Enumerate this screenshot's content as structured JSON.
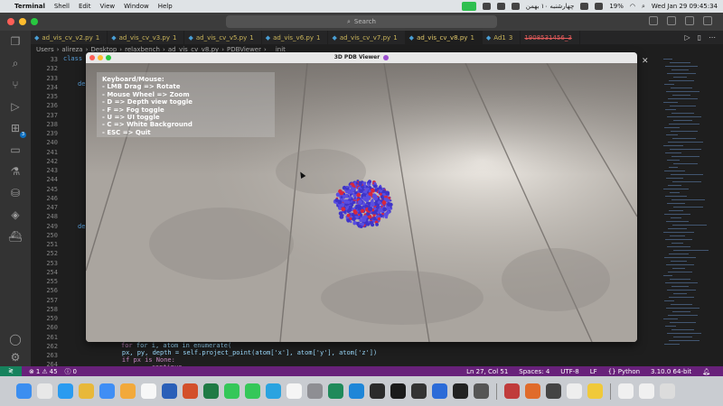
{
  "menubar": {
    "app_name": "Terminal",
    "items": [
      "Shell",
      "Edit",
      "View",
      "Window",
      "Help"
    ],
    "date_fa": "چهارشنبه ۱۰ بهمن",
    "battery": "19%",
    "clock": "Wed Jan 29  09:45:34"
  },
  "titlebar": {
    "search_placeholder": "Search"
  },
  "tabs": [
    {
      "label": "ad_vis_cv_v2.py",
      "badge": "1",
      "icon": "python-icon",
      "active": false,
      "strike": false
    },
    {
      "label": "ad_vis_cv_v3.py",
      "badge": "1",
      "icon": "python-icon",
      "active": false,
      "strike": false
    },
    {
      "label": "ad_vis_cv_v5.py",
      "badge": "1",
      "icon": "python-icon",
      "active": false,
      "strike": false
    },
    {
      "label": "ad_vis_v6.py",
      "badge": "1",
      "icon": "python-icon",
      "active": false,
      "strike": false
    },
    {
      "label": "ad_vis_cv_v7.py",
      "badge": "1",
      "icon": "python-icon",
      "active": false,
      "strike": false
    },
    {
      "label": "ad_vis_cv_v8.py",
      "badge": "1",
      "icon": "python-icon",
      "active": true,
      "strike": false
    },
    {
      "label": "Ad1",
      "badge": "3",
      "icon": "python-icon",
      "active": false,
      "strike": false
    },
    {
      "label": "1908531456_3",
      "badge": "",
      "icon": "",
      "active": false,
      "strike": true
    }
  ],
  "breadcrumb": {
    "parts": [
      "Users",
      "alireza",
      "Desktop",
      "relaxbench",
      "ad_vis_cv_v8.py",
      "PDBViewer",
      "__init__"
    ]
  },
  "editor": {
    "line_numbers": [
      33,
      232,
      233,
      234,
      235,
      236,
      237,
      238,
      239,
      240,
      241,
      242,
      243,
      244,
      245,
      246,
      247,
      248,
      249,
      250,
      251,
      252,
      253,
      254,
      255,
      256,
      257,
      258,
      259,
      260,
      261,
      262,
      263,
      264,
      265,
      266,
      267
    ],
    "fragment_class": "class",
    "fragment_def1": "de",
    "fragment_def2": "de",
    "line_265": "for i, atom in enumerate(",
    "line_266": "    px, py, depth = self.project_point(atom['x'], atom['y'], atom['z'])",
    "line_267": "    if px is None:",
    "line_268": "        continue"
  },
  "viewer": {
    "title": "3D PDB Viewer",
    "help_title": "Keyboard/Mouse:",
    "help_lines": [
      "- LMB Drag => Rotate",
      "- Mouse Wheel => Zoom",
      "- D => Depth view toggle",
      "- F => Fog toggle",
      "- U => UI toggle",
      "- C => White Background",
      "- ESC => Quit"
    ]
  },
  "statusbar": {
    "errors": "1",
    "warnings": "45",
    "info": "0",
    "position": "Ln 27, Col 51",
    "spaces": "Spaces: 4",
    "encoding": "UTF-8",
    "eol": "LF",
    "language": "Python",
    "interpreter": "3.10.0 64-bit"
  },
  "colors": {
    "statusbar": "#68217a",
    "activity_bar": "#333333",
    "editor_bg": "#1e1e1e",
    "protein_blue": "#5a4ee0",
    "protein_red": "#d8283c"
  }
}
